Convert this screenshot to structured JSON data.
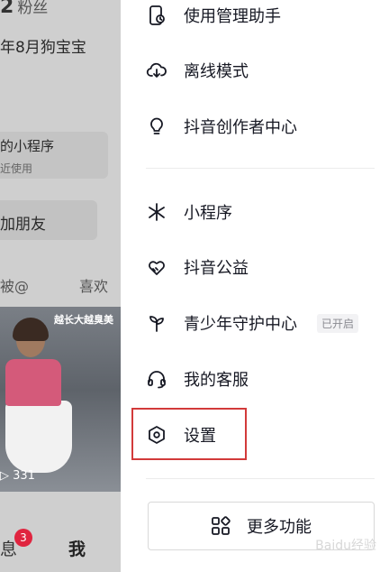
{
  "profile_background": {
    "fans_count": "2",
    "fans_label": "粉丝",
    "bio": "年8月狗宝宝",
    "mini_program_title": "的小程序",
    "mini_program_subtitle": "近使用",
    "add_friend": "加朋友",
    "tab_mentions": "被@",
    "tab_likes": "喜欢",
    "video_overlay": "越长大越臭美",
    "video_views": "331",
    "nav_messages": "息",
    "nav_messages_badge": "3",
    "nav_me": "我"
  },
  "menu": {
    "items": [
      {
        "label": "使用管理助手",
        "icon": "phone-manage-icon"
      },
      {
        "label": "离线模式",
        "icon": "cloud-download-icon"
      },
      {
        "label": "抖音创作者中心",
        "icon": "lightbulb-icon"
      },
      {
        "label": "小程序",
        "icon": "asterisk-icon"
      },
      {
        "label": "抖音公益",
        "icon": "heart-hands-icon"
      },
      {
        "label": "青少年守护中心",
        "icon": "sprout-icon",
        "tag": "已开启"
      },
      {
        "label": "我的客服",
        "icon": "headset-icon"
      },
      {
        "label": "设置",
        "icon": "hexagon-settings-icon"
      }
    ],
    "more_functions": "更多功能"
  },
  "highlight_color": "#d23a3a",
  "watermark": "Baidu经验"
}
